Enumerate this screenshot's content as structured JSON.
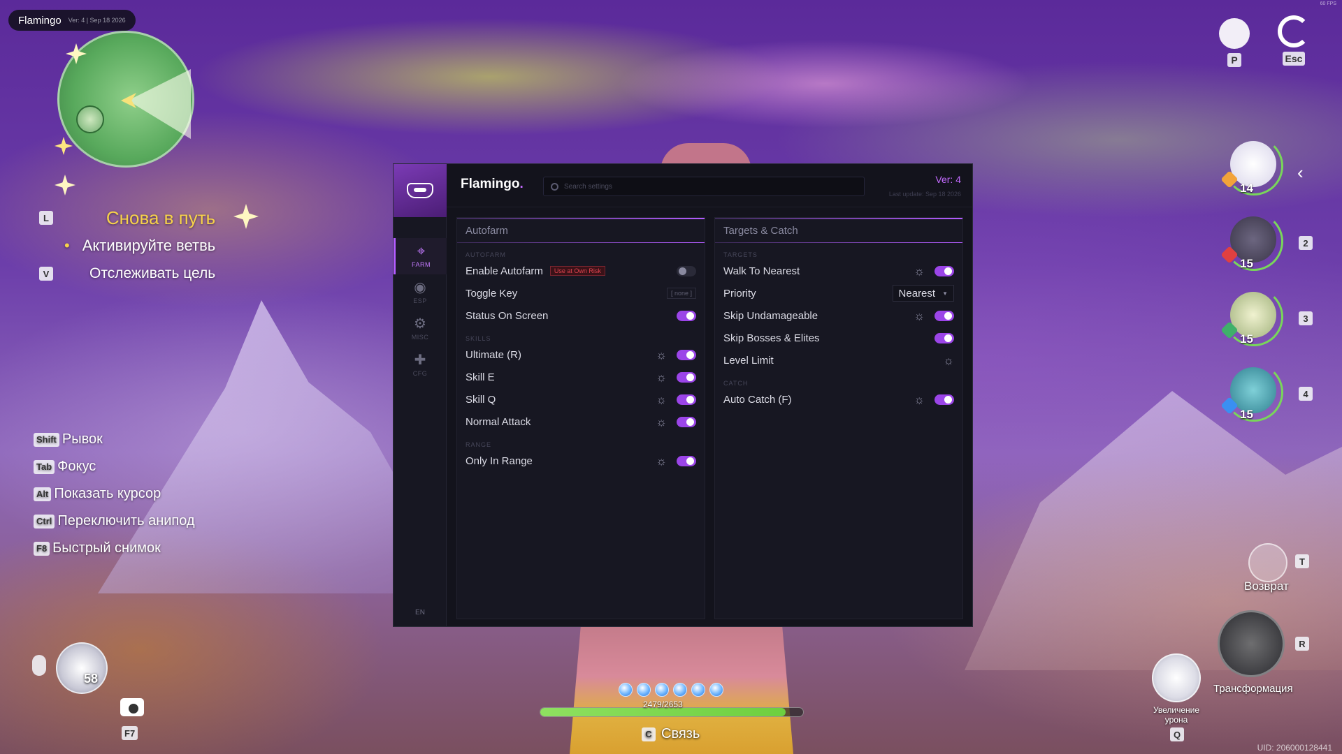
{
  "app": {
    "brand_name": "Flamingo",
    "meta": "Ver: 4 | Sep 18 2026",
    "fps_text": "60 FPS"
  },
  "menu": {
    "brand": "Flamingo",
    "brand_dot": ".",
    "search_placeholder": "Search settings",
    "version": "Ver: 4",
    "last_update": "Last update: Sep 18 2026",
    "language": "EN",
    "nav": [
      {
        "id": "farm",
        "label": "FARM",
        "icon": "crosshair-icon",
        "active": true
      },
      {
        "id": "esp",
        "label": "ESP",
        "icon": "eye-icon",
        "active": false
      },
      {
        "id": "misc",
        "label": "MISC",
        "icon": "gear-icon",
        "active": false
      },
      {
        "id": "cfg",
        "label": "CFG",
        "icon": "puzzle-icon",
        "active": false
      }
    ],
    "autofarm": {
      "title": "Autofarm",
      "section_autofarm": "AUTOFARM",
      "enable_autofarm": {
        "label": "Enable Autofarm",
        "badge": "Use at Own Risk",
        "on": false
      },
      "toggle_key": {
        "label": "Toggle Key",
        "value": "[ none ]"
      },
      "status_on_screen": {
        "label": "Status On Screen",
        "on": true
      },
      "section_skills": "SKILLS",
      "skills": [
        {
          "label": "Ultimate (R)",
          "on": true
        },
        {
          "label": "Skill E",
          "on": true
        },
        {
          "label": "Skill Q",
          "on": true
        },
        {
          "label": "Normal Attack",
          "on": true
        }
      ],
      "section_range": "RANGE",
      "only_in_range": {
        "label": "Only In Range",
        "on": true
      }
    },
    "targets": {
      "title": "Targets & Catch",
      "section_targets": "TARGETS",
      "walk_to_nearest": {
        "label": "Walk To Nearest",
        "on": true
      },
      "priority": {
        "label": "Priority",
        "value": "Nearest"
      },
      "skip_undamageable": {
        "label": "Skip Undamageable",
        "on": true
      },
      "skip_bosses": {
        "label": "Skip Bosses & Elites",
        "on": true
      },
      "level_limit": {
        "label": "Level Limit"
      },
      "section_catch": "CATCH",
      "auto_catch": {
        "label": "Auto Catch (F)",
        "on": true
      }
    }
  },
  "game": {
    "quest": {
      "key_l": "L",
      "title": "Снова в путь",
      "objective": "Активируйте ветвь",
      "key_v": "V",
      "track": "Отслеживать цель"
    },
    "hotkeys": [
      {
        "key": "Shift",
        "label": "Рывок"
      },
      {
        "key": "Tab",
        "label": "Фокус"
      },
      {
        "key": "Alt",
        "label": "Показать курсор"
      },
      {
        "key": "Ctrl",
        "label": "Переключить анипод"
      },
      {
        "key": "F8",
        "label": "Быстрый снимок"
      }
    ],
    "bag_count": "58",
    "camera_key": "F7",
    "hp_text": "2479/2653",
    "hp_fraction": 0.934,
    "link_key": "C",
    "link_label": "Связь",
    "top_right": [
      {
        "key": "P",
        "icon": "pet-icon"
      },
      {
        "key": "Esc",
        "icon": "menu-ring-icon"
      }
    ],
    "party": [
      {
        "slot": "",
        "level": "14",
        "color": "#e8e6f2"
      },
      {
        "slot": "2",
        "level": "15",
        "color": "#4a4558"
      },
      {
        "slot": "3",
        "level": "15",
        "color": "#cfd7a8"
      },
      {
        "slot": "4",
        "level": "15",
        "color": "#3f8f9f"
      }
    ],
    "return_label": "Возврат",
    "return_key": "T",
    "transform_label": "Трансформация",
    "transform_key": "R",
    "damage_label": "Увеличение урона",
    "damage_key": "Q",
    "uid": "UID: 206000128441"
  }
}
